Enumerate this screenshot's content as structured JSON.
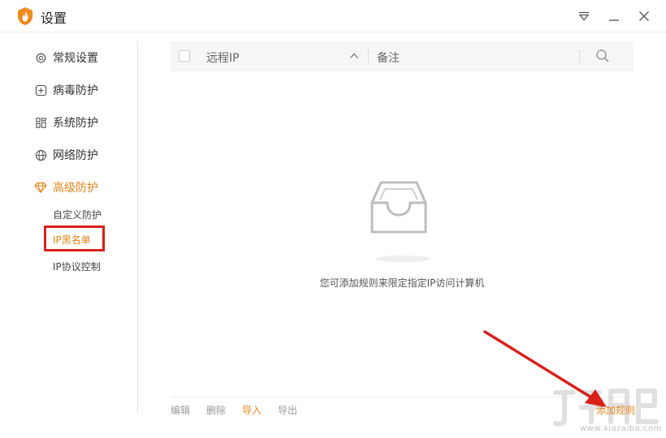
{
  "window": {
    "title": "设置",
    "logo_icon": "shield-flame-icon",
    "controls": [
      "menu-icon",
      "minimize-icon",
      "close-icon"
    ]
  },
  "sidebar": {
    "items": [
      {
        "label": "常规设置",
        "icon": "gear-icon"
      },
      {
        "label": "病毒防护",
        "icon": "plus-square-icon"
      },
      {
        "label": "系统防护",
        "icon": "grid-icon"
      },
      {
        "label": "网络防护",
        "icon": "globe-icon"
      },
      {
        "label": "高级防护",
        "icon": "diamond-icon",
        "active": true
      }
    ],
    "sub_items": [
      {
        "label": "自定义防护"
      },
      {
        "label": "IP黑名单",
        "active": true
      },
      {
        "label": "IP协议控制"
      }
    ]
  },
  "table": {
    "columns": [
      "远程IP",
      "备注"
    ],
    "rows": []
  },
  "empty_state": {
    "icon": "empty-inbox-icon",
    "message": "您可添加规则来限定指定IP访问计算机"
  },
  "footer": {
    "actions": [
      "编辑",
      "删除",
      "导入",
      "导出"
    ],
    "add_rule": "添加规则"
  },
  "colors": {
    "accent": "#e2851b",
    "annotation": "#d9201b"
  },
  "watermark": {
    "text": "www.xiazaiba.com"
  }
}
